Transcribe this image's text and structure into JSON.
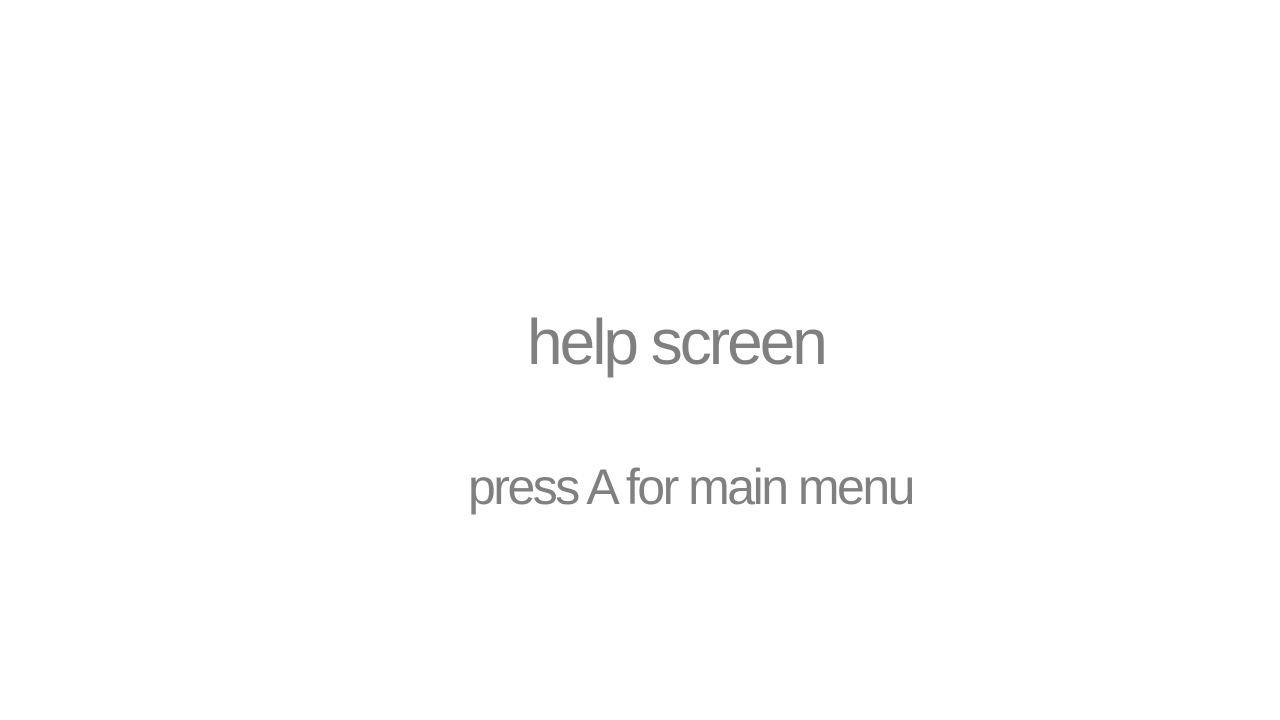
{
  "screen": {
    "title": "help screen",
    "hint": "press A for main menu",
    "background_color": "#ffffff",
    "text_color": "#808080"
  }
}
